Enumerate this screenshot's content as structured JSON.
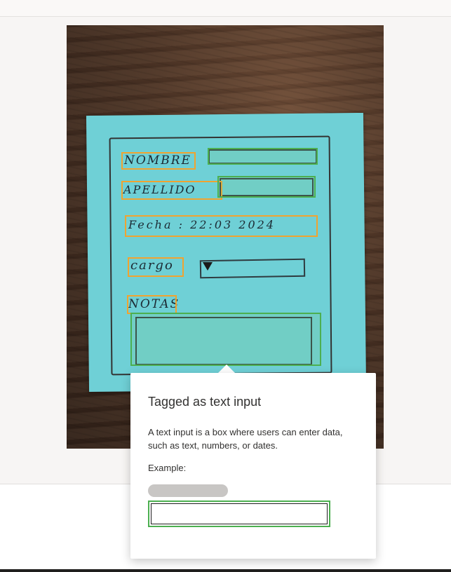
{
  "image_area": {
    "handwritten_labels": {
      "nombre": "NOMBRE",
      "apellido": "APELLIDO",
      "fecha": "Fecha : 22:03 2024",
      "cargo": "cargo",
      "notas": "NOTAS"
    }
  },
  "tooltip": {
    "title": "Tagged as text input",
    "description": "A text input is a box where users can enter data, such as text, numbers, or dates.",
    "example_label": "Example:"
  },
  "colors": {
    "label_tag": "#f0a330",
    "input_tag": "#4caf50",
    "sticky_note": "#6fd0d6"
  }
}
